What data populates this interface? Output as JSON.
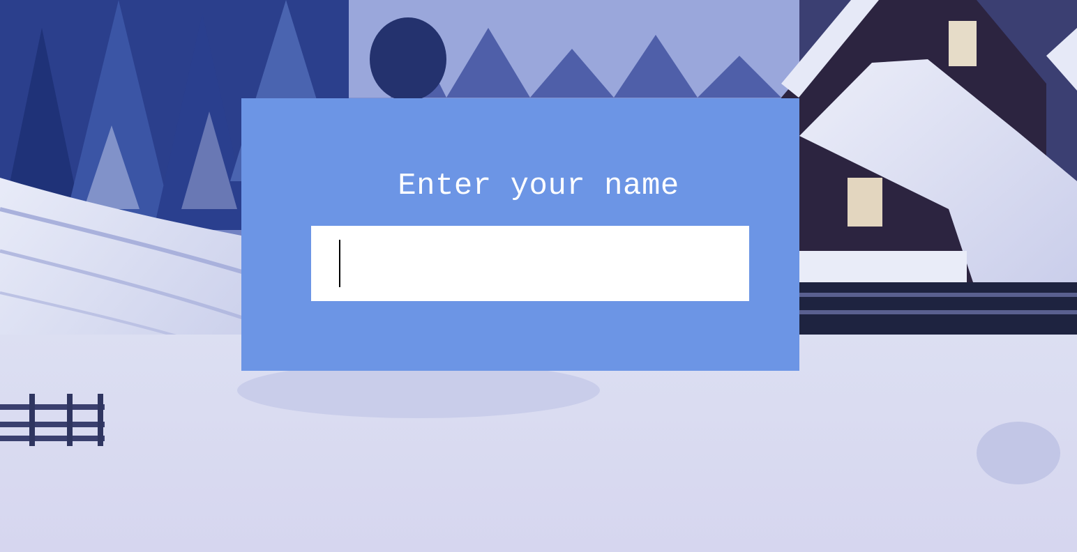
{
  "dialog": {
    "prompt": "Enter your name",
    "name_input_value": "",
    "background_color": "#6c95e5"
  },
  "background": {
    "icon": "winter-cabin-scene"
  }
}
